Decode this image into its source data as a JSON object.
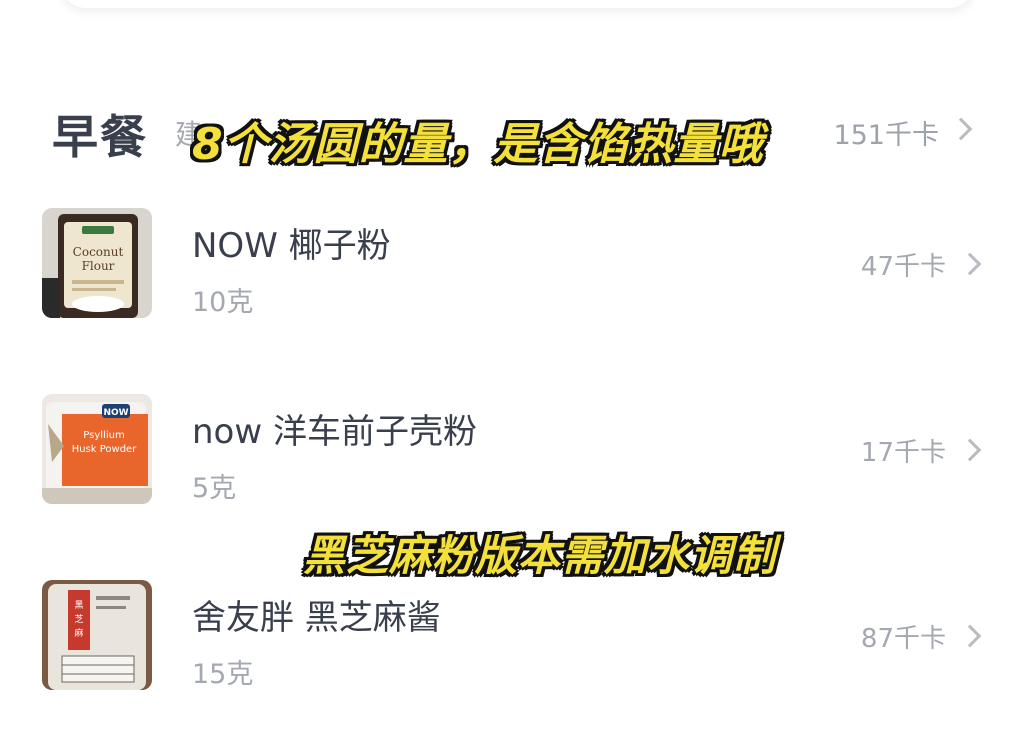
{
  "section": {
    "title": "早餐",
    "hint": "建",
    "total": "151千卡"
  },
  "items": [
    {
      "name": "NOW 椰子粉",
      "amount": "10克",
      "kcal": "47千卡",
      "thumb_icon": "coconut-flour-bag"
    },
    {
      "name": "now 洋车前子壳粉",
      "amount": "5克",
      "kcal": "17千卡",
      "thumb_icon": "psyllium-husk-bag"
    },
    {
      "name": "舍友胖 黑芝麻酱",
      "amount": "15克",
      "kcal": "87千卡",
      "thumb_icon": "sesame-paste-jar"
    }
  ],
  "overlay": {
    "caption_1": "8个汤圆的量，是含馅热量哦",
    "caption_2": "黑芝麻粉版本需加水调制"
  },
  "colors": {
    "title_text": "#3a3f4d",
    "secondary_text": "#a4a8b1",
    "caption_fill": "#f4e03a",
    "caption_outline": "#111111"
  }
}
